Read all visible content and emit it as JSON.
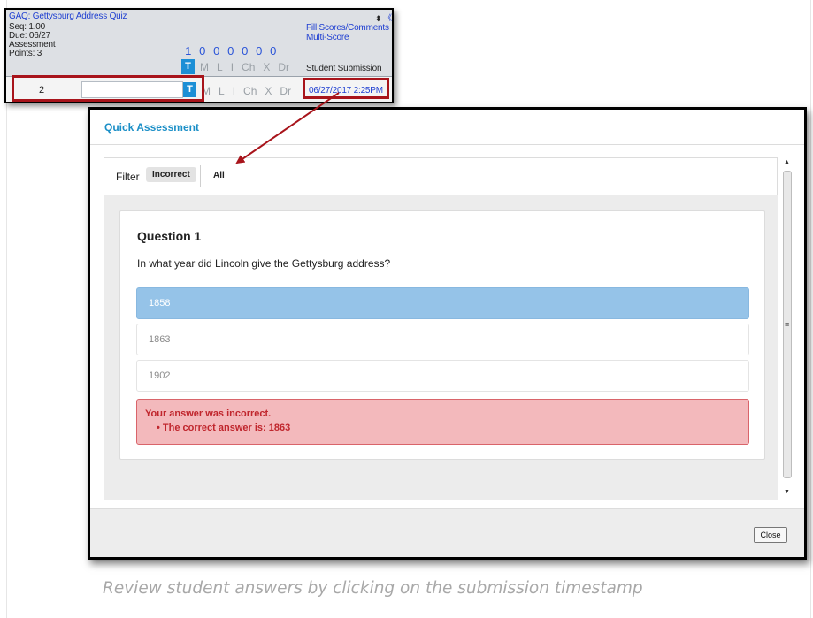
{
  "gradebook": {
    "assignment_title": "GAQ: Gettysburg Address Quiz",
    "seq": "Seq: 1.00",
    "due": "Due: 06/27",
    "category": "Assessment",
    "points": "Points: 3",
    "sort_icon": "⬍",
    "collapse_icon": "《",
    "fill_scores_link": "Fill Scores/Comments",
    "multi_score_link": "Multi-Score",
    "score_counts": [
      "1",
      "0",
      "0",
      "0",
      "0",
      "0",
      "0"
    ],
    "flag_codes": [
      "T",
      "M",
      "L",
      "I",
      "Ch",
      "X",
      "Dr"
    ],
    "student_submission_label": "Student Submission",
    "student_row": {
      "row_number": "2",
      "score_value": "",
      "submission_timestamp": "06/27/2017 2:25PM"
    }
  },
  "dialog": {
    "title": "Quick Assessment",
    "filter": {
      "label": "Filter",
      "incorrect_label": "Incorrect",
      "all_label": "All"
    },
    "question": {
      "title": "Question 1",
      "text": "In what year did Lincoln give the Gettysburg address?",
      "options": [
        {
          "label": "1858",
          "selected": true
        },
        {
          "label": "1863",
          "selected": false
        },
        {
          "label": "1902",
          "selected": false
        }
      ],
      "feedback_heading": "Your answer was incorrect.",
      "feedback_detail": "The correct answer is: 1863"
    },
    "close_label": "Close"
  },
  "caption": "Review student answers by clicking on the submission timestamp",
  "colors": {
    "accent": "#1b8fc7",
    "selected_option": "#95c3e8",
    "error_bg": "#f3b9bc",
    "error_text": "#c0262d",
    "highlight_box": "#a8141b"
  }
}
